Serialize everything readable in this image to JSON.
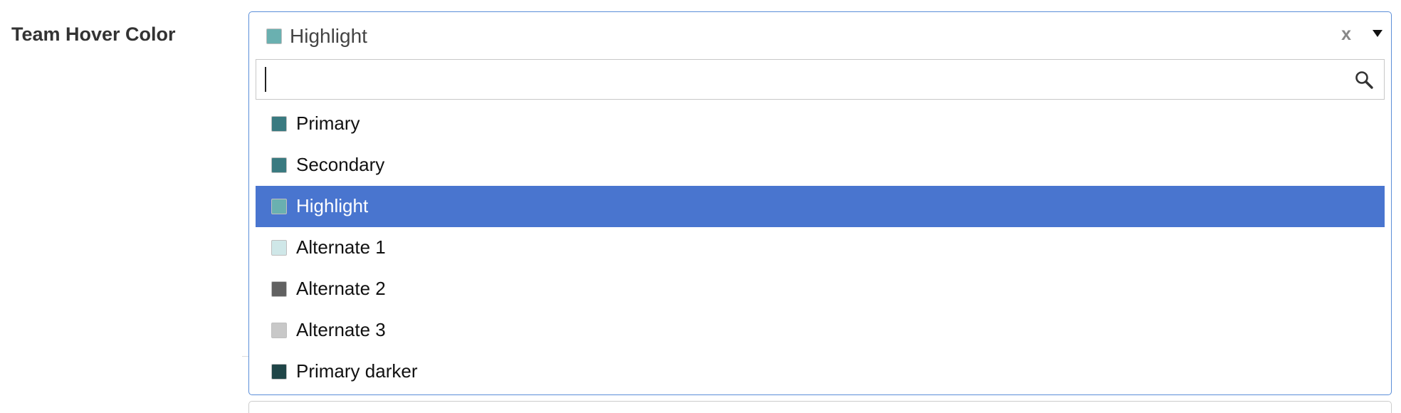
{
  "field": {
    "label": "Team Hover Color"
  },
  "select": {
    "selected_label": "Highlight",
    "selected_color": "#6ab0b0",
    "clear_label": "x",
    "caret_icon": "caret-down-icon",
    "search": {
      "value": "",
      "placeholder": "",
      "icon": "search-icon"
    },
    "options": [
      {
        "label": "Primary",
        "color": "#3a7a80",
        "active": false
      },
      {
        "label": "Secondary",
        "color": "#3a7a80",
        "active": false
      },
      {
        "label": "Highlight",
        "color": "#6ab0b0",
        "active": true
      },
      {
        "label": "Alternate 1",
        "color": "#cfe7e8",
        "active": false
      },
      {
        "label": "Alternate 2",
        "color": "#616161",
        "active": false
      },
      {
        "label": "Alternate 3",
        "color": "#c8c8c8",
        "active": false
      },
      {
        "label": "Primary darker",
        "color": "#1f4547",
        "active": false
      }
    ]
  },
  "colors": {
    "accent": "#4975cf",
    "focus_border": "#5b8ed8"
  }
}
